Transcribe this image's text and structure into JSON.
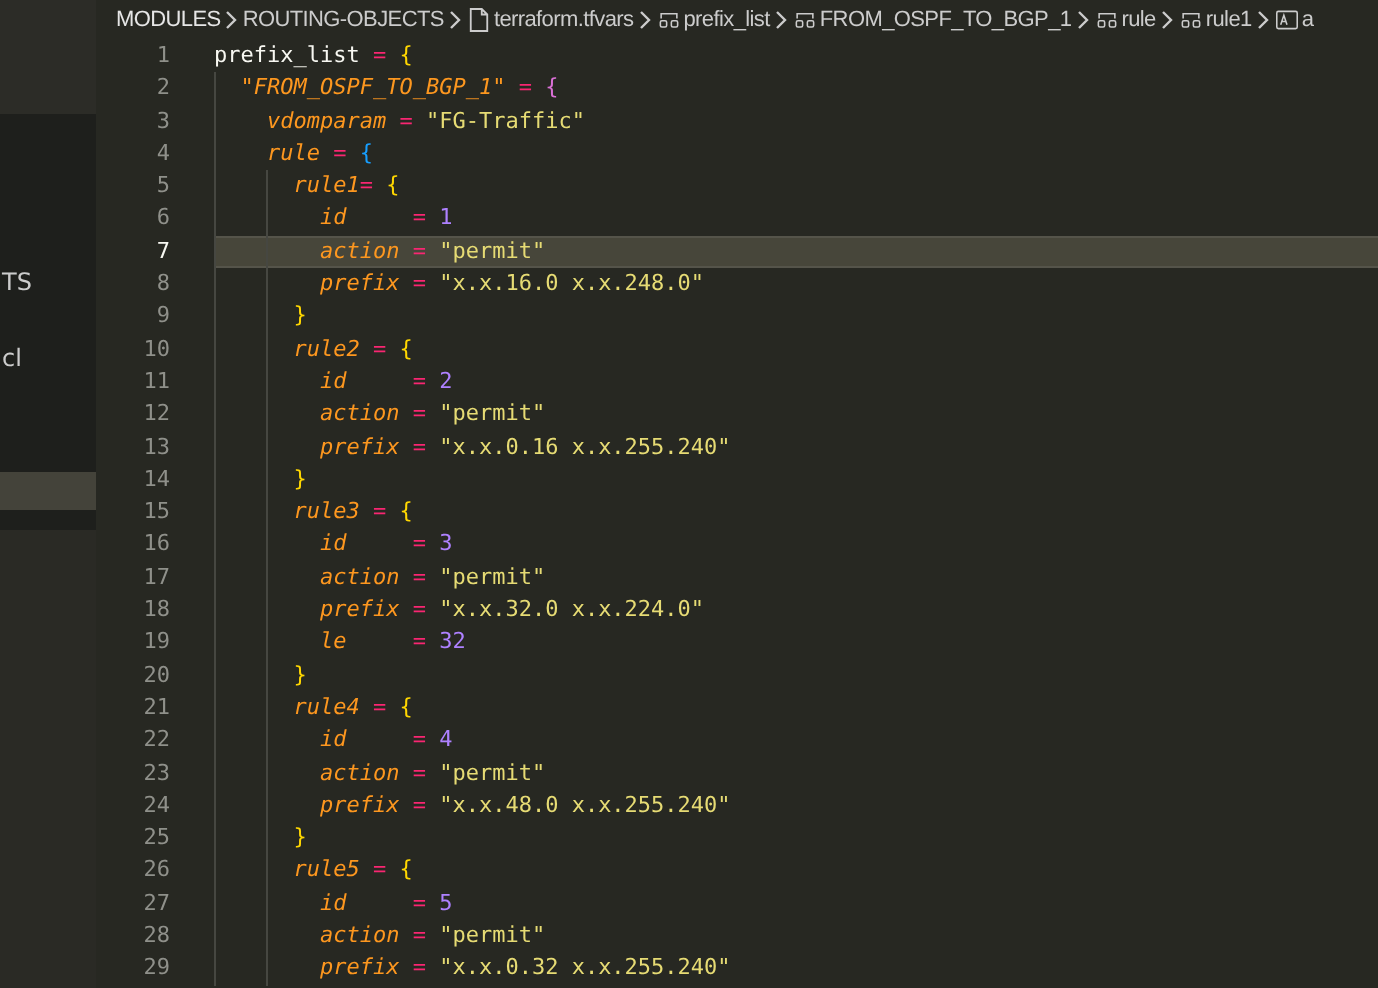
{
  "sidebar": {
    "items": [
      {
        "label": "TS",
        "selected": false
      },
      {
        "label": "cl",
        "selected": false
      },
      {
        "selected": true
      }
    ]
  },
  "breadcrumb": [
    {
      "kind": "folder",
      "label": "MODULES"
    },
    {
      "kind": "folder",
      "label": "ROUTING-OBJECTS"
    },
    {
      "kind": "file",
      "label": "terraform.tfvars"
    },
    {
      "kind": "object",
      "label": "prefix_list"
    },
    {
      "kind": "object",
      "label": "FROM_OSPF_TO_BGP_1"
    },
    {
      "kind": "object",
      "label": "rule"
    },
    {
      "kind": "object",
      "label": "rule1"
    },
    {
      "kind": "field",
      "label": "a"
    }
  ],
  "lines": [
    {
      "number": "1",
      "current": false,
      "tokens": [
        {
          "kind": "name",
          "text": "prefix_list"
        },
        {
          "kind": "op",
          "text": " = "
        },
        {
          "kind": "punct",
          "text": "{"
        }
      ]
    },
    {
      "number": "2",
      "current": false,
      "tokens": [
        {
          "kind": "key",
          "text": "  \"FROM_OSPF_TO_BGP_1\""
        },
        {
          "kind": "op",
          "text": " = "
        },
        {
          "kind": "punct-inner",
          "text": "{"
        }
      ]
    },
    {
      "number": "3",
      "current": false,
      "tokens": [
        {
          "kind": "key",
          "text": "    vdomparam"
        },
        {
          "kind": "op",
          "text": " = "
        },
        {
          "kind": "string",
          "text": "\"FG-Traffic\""
        }
      ]
    },
    {
      "number": "4",
      "current": false,
      "tokens": [
        {
          "kind": "key",
          "text": "    rule"
        },
        {
          "kind": "op",
          "text": " = "
        },
        {
          "kind": "punct-deep",
          "text": "{"
        }
      ]
    },
    {
      "number": "5",
      "current": false,
      "tokens": [
        {
          "kind": "key",
          "text": "      rule1"
        },
        {
          "kind": "op",
          "text": "= "
        },
        {
          "kind": "punct",
          "text": "{"
        }
      ]
    },
    {
      "number": "6",
      "current": false,
      "tokens": [
        {
          "kind": "key",
          "text": "        id"
        },
        {
          "kind": "op",
          "text": "     = "
        },
        {
          "kind": "number",
          "text": "1"
        }
      ]
    },
    {
      "number": "7",
      "current": true,
      "tokens": [
        {
          "kind": "key",
          "text": "        action"
        },
        {
          "kind": "op",
          "text": " = "
        },
        {
          "kind": "string",
          "text": "\"permit\""
        }
      ]
    },
    {
      "number": "8",
      "current": false,
      "tokens": [
        {
          "kind": "key",
          "text": "        prefix"
        },
        {
          "kind": "op",
          "text": " = "
        },
        {
          "kind": "string",
          "text": "\"x.x.16.0 x.x.248.0\""
        }
      ]
    },
    {
      "number": "9",
      "current": false,
      "tokens": [
        {
          "kind": "punct",
          "text": "      }"
        }
      ]
    },
    {
      "number": "10",
      "current": false,
      "tokens": [
        {
          "kind": "key",
          "text": "      rule2"
        },
        {
          "kind": "op",
          "text": " = "
        },
        {
          "kind": "punct",
          "text": "{"
        }
      ]
    },
    {
      "number": "11",
      "current": false,
      "tokens": [
        {
          "kind": "key",
          "text": "        id"
        },
        {
          "kind": "op",
          "text": "     = "
        },
        {
          "kind": "number",
          "text": "2"
        }
      ]
    },
    {
      "number": "12",
      "current": false,
      "tokens": [
        {
          "kind": "key",
          "text": "        action"
        },
        {
          "kind": "op",
          "text": " = "
        },
        {
          "kind": "string",
          "text": "\"permit\""
        }
      ]
    },
    {
      "number": "13",
      "current": false,
      "tokens": [
        {
          "kind": "key",
          "text": "        prefix"
        },
        {
          "kind": "op",
          "text": " = "
        },
        {
          "kind": "string",
          "text": "\"x.x.0.16 x.x.255.240\""
        }
      ]
    },
    {
      "number": "14",
      "current": false,
      "tokens": [
        {
          "kind": "punct",
          "text": "      }"
        }
      ]
    },
    {
      "number": "15",
      "current": false,
      "tokens": [
        {
          "kind": "key",
          "text": "      rule3"
        },
        {
          "kind": "op",
          "text": " = "
        },
        {
          "kind": "punct",
          "text": "{"
        }
      ]
    },
    {
      "number": "16",
      "current": false,
      "tokens": [
        {
          "kind": "key",
          "text": "        id"
        },
        {
          "kind": "op",
          "text": "     = "
        },
        {
          "kind": "number",
          "text": "3"
        }
      ]
    },
    {
      "number": "17",
      "current": false,
      "tokens": [
        {
          "kind": "key",
          "text": "        action"
        },
        {
          "kind": "op",
          "text": " = "
        },
        {
          "kind": "string",
          "text": "\"permit\""
        }
      ]
    },
    {
      "number": "18",
      "current": false,
      "tokens": [
        {
          "kind": "key",
          "text": "        prefix"
        },
        {
          "kind": "op",
          "text": " = "
        },
        {
          "kind": "string",
          "text": "\"x.x.32.0 x.x.224.0\""
        }
      ]
    },
    {
      "number": "19",
      "current": false,
      "tokens": [
        {
          "kind": "key",
          "text": "        le"
        },
        {
          "kind": "op",
          "text": "     = "
        },
        {
          "kind": "number",
          "text": "32"
        }
      ]
    },
    {
      "number": "20",
      "current": false,
      "tokens": [
        {
          "kind": "punct",
          "text": "      }"
        }
      ]
    },
    {
      "number": "21",
      "current": false,
      "tokens": [
        {
          "kind": "key",
          "text": "      rule4"
        },
        {
          "kind": "op",
          "text": " = "
        },
        {
          "kind": "punct",
          "text": "{"
        }
      ]
    },
    {
      "number": "22",
      "current": false,
      "tokens": [
        {
          "kind": "key",
          "text": "        id"
        },
        {
          "kind": "op",
          "text": "     = "
        },
        {
          "kind": "number",
          "text": "4"
        }
      ]
    },
    {
      "number": "23",
      "current": false,
      "tokens": [
        {
          "kind": "key",
          "text": "        action"
        },
        {
          "kind": "op",
          "text": " = "
        },
        {
          "kind": "string",
          "text": "\"permit\""
        }
      ]
    },
    {
      "number": "24",
      "current": false,
      "tokens": [
        {
          "kind": "key",
          "text": "        prefix"
        },
        {
          "kind": "op",
          "text": " = "
        },
        {
          "kind": "string",
          "text": "\"x.x.48.0 x.x.255.240\""
        }
      ]
    },
    {
      "number": "25",
      "current": false,
      "tokens": [
        {
          "kind": "punct",
          "text": "      }"
        }
      ]
    },
    {
      "number": "26",
      "current": false,
      "tokens": [
        {
          "kind": "key",
          "text": "      rule5"
        },
        {
          "kind": "op",
          "text": " = "
        },
        {
          "kind": "punct",
          "text": "{"
        }
      ]
    },
    {
      "number": "27",
      "current": false,
      "tokens": [
        {
          "kind": "key",
          "text": "        id"
        },
        {
          "kind": "op",
          "text": "     = "
        },
        {
          "kind": "number",
          "text": "5"
        }
      ]
    },
    {
      "number": "28",
      "current": false,
      "tokens": [
        {
          "kind": "key",
          "text": "        action"
        },
        {
          "kind": "op",
          "text": " = "
        },
        {
          "kind": "string",
          "text": "\"permit\""
        }
      ]
    },
    {
      "number": "29",
      "current": false,
      "tokens": [
        {
          "kind": "key",
          "text": "        prefix"
        },
        {
          "kind": "op",
          "text": " = "
        },
        {
          "kind": "string",
          "text": "\"x.x.0.32 x.x.255.240\""
        }
      ]
    }
  ]
}
